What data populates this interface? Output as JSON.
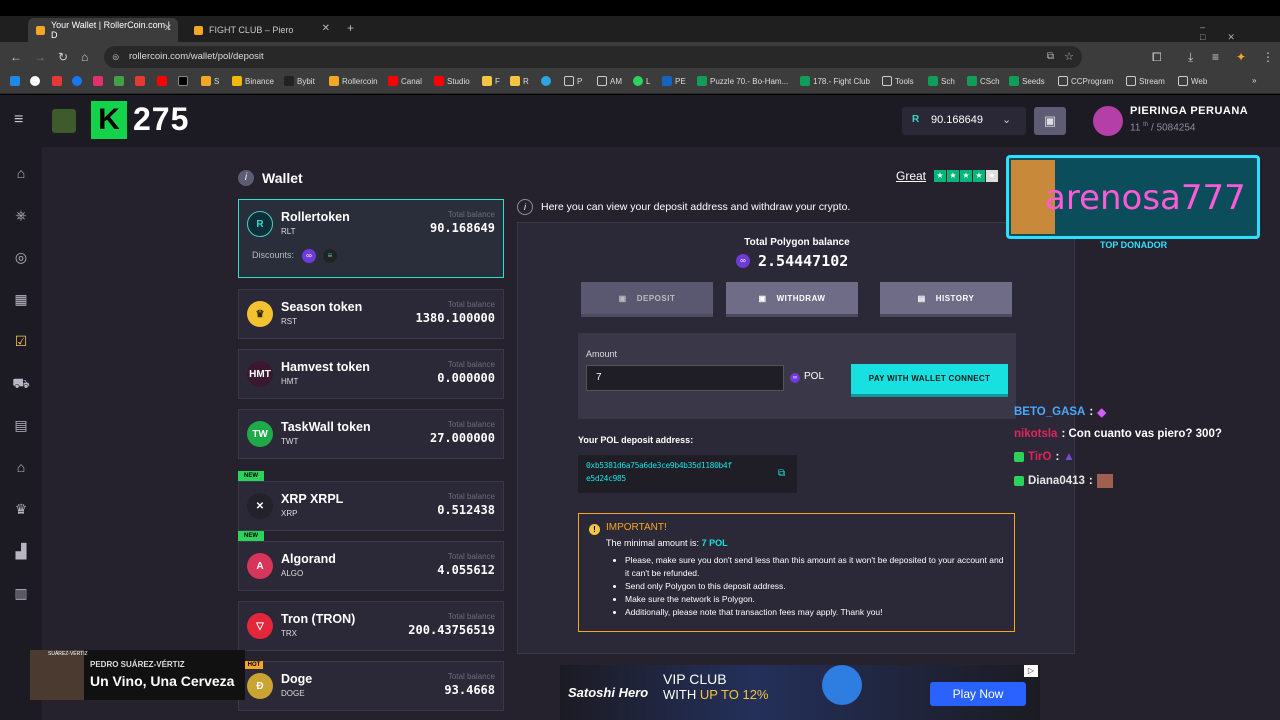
{
  "browser": {
    "tabs": [
      {
        "label": "Your Wallet | RollerCoin.com | D",
        "active": true
      },
      {
        "label": "FIGHT CLUB – Piero",
        "active": false
      }
    ],
    "url": "rollercoin.com/wallet/pol/deposit",
    "bookmarks": [
      "S",
      "Binance",
      "Bybit",
      "Rollercoin",
      "Canal",
      "Studio",
      "F",
      "R",
      "P",
      "AM",
      "L",
      "PE",
      "Puzzle 70.- Bo-Ham...",
      "178.- Fight Club",
      "Tools",
      "Sch",
      "CSch",
      "Seeds",
      "CCProgram",
      "Stream",
      "Web"
    ]
  },
  "header": {
    "level": "275",
    "balance": "90.168649",
    "balance_symbol": "R",
    "username": "PIERINGA PERUANA",
    "rank": "11",
    "rank_sup": "th",
    "rank_total": "/ 5084254"
  },
  "wallet": {
    "title": "Wallet",
    "rating_label": "Great",
    "info_text": "Here you can view your deposit address and withdraw your crypto.",
    "discounts_label": "Discounts:",
    "total_balance_label": "Total balance",
    "tokens": [
      {
        "name": "Rollertoken",
        "symbol": "RLT",
        "value": "90.168649",
        "icon": "R",
        "color": "#0e2f3a",
        "fg": "#39d6c8",
        "new": false,
        "selected": true
      },
      {
        "name": "Season token",
        "symbol": "RST",
        "value": "1380.100000",
        "icon": "♛",
        "color": "#f2c230",
        "fg": "#3a2a00",
        "new": false,
        "selected": false
      },
      {
        "name": "Hamvest token",
        "symbol": "HMT",
        "value": "0.000000",
        "icon": "HMT",
        "color": "#3a1830",
        "fg": "#ffffff",
        "new": false,
        "selected": false
      },
      {
        "name": "TaskWall token",
        "symbol": "TWT",
        "value": "27.000000",
        "icon": "TW",
        "color": "#1faa4a",
        "fg": "#ffffff",
        "new": false,
        "selected": false
      },
      {
        "name": "XRP XRPL",
        "symbol": "XRP",
        "value": "0.512438",
        "icon": "✕",
        "color": "#23222b",
        "fg": "#ffffff",
        "new": true,
        "selected": false
      },
      {
        "name": "Algorand",
        "symbol": "ALGO",
        "value": "4.055612",
        "icon": "A",
        "color": "#d8355a",
        "fg": "#ffffff",
        "new": true,
        "selected": false
      },
      {
        "name": "Tron (TRON)",
        "symbol": "TRX",
        "value": "200.43756519",
        "icon": "▽",
        "color": "#e3263a",
        "fg": "#ffffff",
        "new": false,
        "selected": false
      },
      {
        "name": "Doge",
        "symbol": "DOGE",
        "value": "93.4668",
        "icon": "Ð",
        "color": "#c9a432",
        "fg": "#ffffff",
        "new": false,
        "selected": false
      }
    ],
    "new_badge": "NEW"
  },
  "panel": {
    "balance_title": "Total Polygon balance",
    "balance_value": "2.54447102",
    "deposit_label": "DEPOSIT",
    "withdraw_label": "WITHDRAW",
    "history_label": "HISTORY",
    "amount_label": "Amount",
    "amount_value": "7",
    "currency": "POL",
    "pay_label": "PAY WITH WALLET CONNECT",
    "address_label": "Your POL deposit address:",
    "address_line1": "0xb5381d6a75a6de3ce9b4b35d1180b4f",
    "address_line2": "e5d24c985",
    "important_title": "IMPORTANT!",
    "minimal_text": "The minimal amount is:",
    "minimal_value": "7 POL",
    "notes": [
      "Please, make sure you don't send less than this amount as it won't be deposited to your account and it can't be refunded.",
      "Send only Polygon to this deposit address.",
      "Make sure the network is Polygon.",
      "Additionally, please note that transaction fees may apply. Thank you!"
    ]
  },
  "overlay": {
    "donor_name": "arenosa777",
    "donor_label": "TOP DONADOR",
    "chat": [
      {
        "user": "BETO_GASA",
        "msg": ":",
        "color": "#4aa8ff"
      },
      {
        "user": "nikotsla",
        "msg": ": Con cuanto vas piero? 300?",
        "color": "#e0245e"
      },
      {
        "user": "TirO",
        "msg": ":",
        "color": "#e0245e"
      },
      {
        "user": "Diana0413",
        "msg": ":",
        "color": "#e8e8e8"
      }
    ],
    "music_artist": "PEDRO SUÁREZ-VÉRTIZ",
    "music_song": "Un Vino, Una Cerveza",
    "music_tag": "SUÁREZ-VÉRTIZ"
  },
  "ad": {
    "brand": "Satoshi Hero",
    "line1": "VIP CLUB",
    "line2_prefix": "WITH ",
    "line2_highlight": "UP TO 12%",
    "cta": "Play Now",
    "hot_badge": "HOT"
  }
}
